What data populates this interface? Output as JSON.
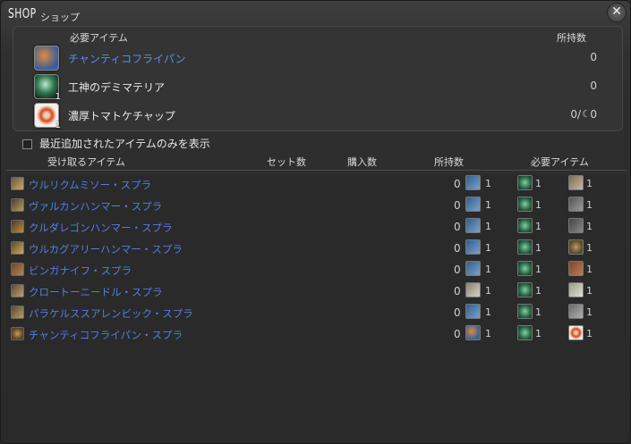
{
  "window": {
    "title": "SHOP",
    "subtitle": "ショップ",
    "close_icon": "close-icon"
  },
  "required_panel": {
    "header_item": "必要アイテム",
    "header_owned": "所持数",
    "items": [
      {
        "name": "チャンティコフライパン",
        "owned": "0",
        "qty": "",
        "highlight": true
      },
      {
        "name": "工神のデミマテリア",
        "owned": "0",
        "qty": "1",
        "highlight": false
      },
      {
        "name": "濃厚トマトケチャップ",
        "owned": "0/",
        "owned_suffix": "0",
        "qty": "1",
        "highlight": false,
        "hq_icon": "hq-icon"
      }
    ]
  },
  "filter": {
    "label": "最近追加されたアイテムのみを表示",
    "checked": false
  },
  "columns": {
    "item": "受け取るアイテム",
    "set": "セット数",
    "buy": "購入数",
    "owned": "所持数",
    "required": "必要アイテム"
  },
  "rows": [
    {
      "name": "ウルリクムミソー・スプラ",
      "owned": "0",
      "q1": "1",
      "q2": "1",
      "q3": "1"
    },
    {
      "name": "ヴァルカンハンマー・スプラ",
      "owned": "0",
      "q1": "1",
      "q2": "1",
      "q3": "1"
    },
    {
      "name": "クルダレゴンハンマー・スプラ",
      "owned": "0",
      "q1": "1",
      "q2": "1",
      "q3": "1"
    },
    {
      "name": "ウルカグアリーハンマー・スプラ",
      "owned": "0",
      "q1": "1",
      "q2": "1",
      "q3": "1"
    },
    {
      "name": "ビンガナイフ・スプラ",
      "owned": "0",
      "q1": "1",
      "q2": "1",
      "q3": "1"
    },
    {
      "name": "クロートーニードル・スプラ",
      "owned": "0",
      "q1": "1",
      "q2": "1",
      "q3": "1"
    },
    {
      "name": "パラケルススアレンビック・スプラ",
      "owned": "0",
      "q1": "1",
      "q2": "1",
      "q3": "1"
    },
    {
      "name": "チャンティコフライパン・スプラ",
      "owned": "0",
      "q1": "1",
      "q2": "1",
      "q3": "1"
    }
  ]
}
